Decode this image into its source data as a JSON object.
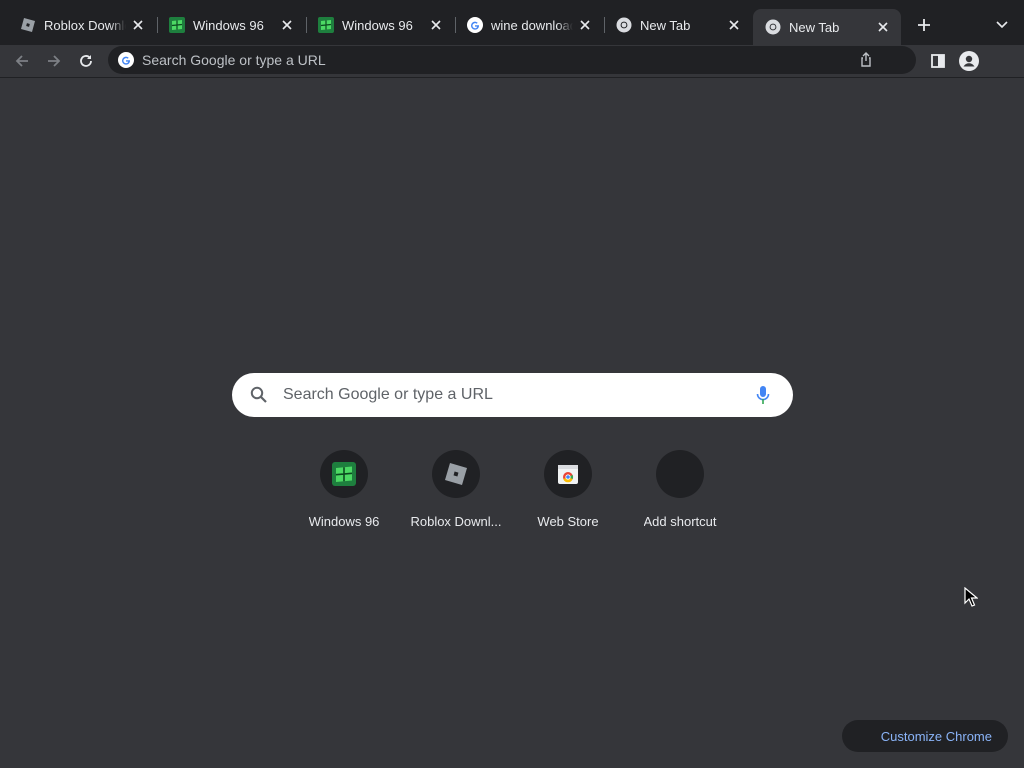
{
  "tabs": [
    {
      "title": "Roblox Downlo",
      "favicon": "roblox-icon",
      "active": false
    },
    {
      "title": "Windows 96",
      "favicon": "windows96-icon",
      "active": false
    },
    {
      "title": "Windows 96",
      "favicon": "windows96-icon",
      "active": false
    },
    {
      "title": "wine download",
      "favicon": "google-icon",
      "active": false
    },
    {
      "title": "New Tab",
      "favicon": "chrome-icon",
      "active": false
    },
    {
      "title": "New Tab",
      "favicon": "chrome-icon",
      "active": true
    }
  ],
  "omnibox": {
    "placeholder": "Search Google or type a URL"
  },
  "ntp": {
    "search_placeholder": "Search Google or type a URL",
    "shortcuts": [
      {
        "label": "Windows 96",
        "icon": "windows96-icon"
      },
      {
        "label": "Roblox Downl...",
        "icon": "roblox-icon"
      },
      {
        "label": "Web Store",
        "icon": "web-store-icon"
      },
      {
        "label": "Add shortcut",
        "icon": "add-icon"
      }
    ],
    "customize_label": "Customize Chrome"
  },
  "colors": {
    "background": "#35363a",
    "tabstrip": "#202124",
    "accent_link": "#8ab4f8"
  }
}
